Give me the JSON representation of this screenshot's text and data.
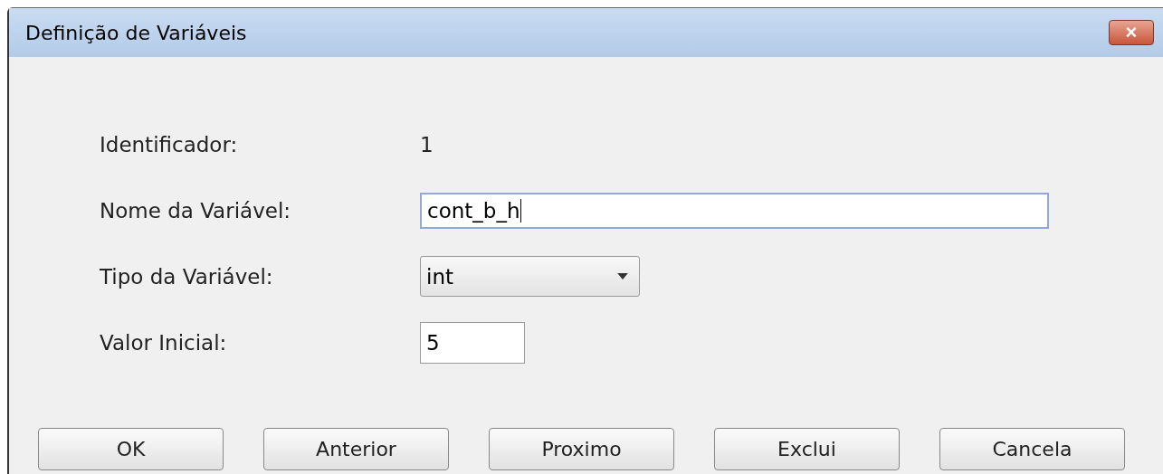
{
  "window": {
    "title": "Definição de Variáveis",
    "close": "×"
  },
  "fields": [
    {
      "kind": "text",
      "label": "Identificador:",
      "value": "1"
    },
    {
      "kind": "input",
      "label": "Nome da Variável:",
      "value": "cont_b_h",
      "focused": true
    },
    {
      "kind": "select",
      "label": "Tipo da Variável:",
      "value": "int"
    },
    {
      "kind": "small-input",
      "label": "Valor Inicial:",
      "value": "5",
      "focused": false
    }
  ],
  "buttons": [
    "OK",
    "Anterior",
    "Proximo",
    "Exclui",
    "Cancela"
  ]
}
